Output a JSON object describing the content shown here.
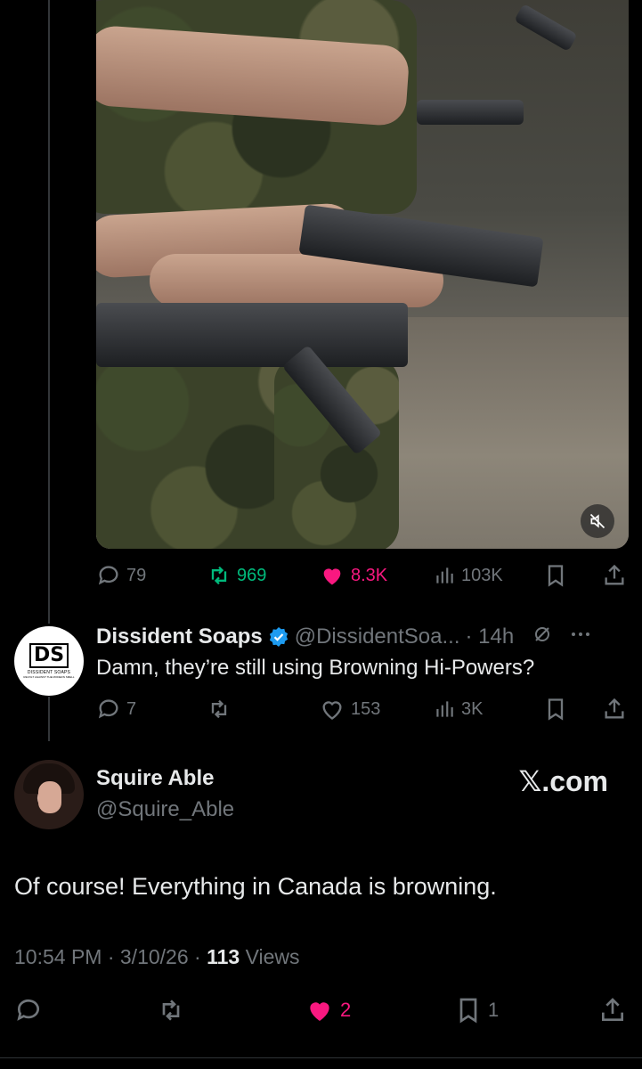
{
  "colors": {
    "background": "#000000",
    "text": "#e7e9ea",
    "muted": "#71767b",
    "retweet_green": "#00ba7c",
    "like_pink": "#f91880",
    "verified_blue": "#1d9bf0"
  },
  "quoted_media": {
    "mute_icon": "muted-speaker-icon"
  },
  "original_actions": {
    "replies": "79",
    "retweets": "969",
    "likes": "8.3K",
    "views": "103K"
  },
  "reply_tweet": {
    "author_name": "Dissident Soaps",
    "handle": "@DissidentSoa...",
    "time": "· 14h",
    "text": "Damn, they’re still using Browning Hi-Powers?",
    "avatar_logo": "DS",
    "avatar_subtitle": "DISSIDENT SOAPS",
    "avatar_tagline": "REVOLT AGAINST THE MODERN SMELL",
    "replies": "7",
    "retweets": "",
    "likes": "153",
    "views": "3K"
  },
  "main_tweet": {
    "author_name": "Squire Able",
    "handle": "@Squire_Able",
    "source_badge": "𝕏.com",
    "text": "Of course! Everything in Canada is browning.",
    "time": "10:54 PM · 3/10/26 · ",
    "views_count": "113",
    "views_label": " Views",
    "likes": "2",
    "bookmarks": "1"
  }
}
